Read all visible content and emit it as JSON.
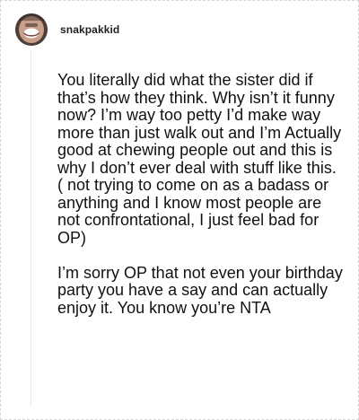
{
  "post": {
    "username": "snakpakkid",
    "avatar_icon": "user-avatar-icon",
    "paragraphs": [
      "You literally did what the sister did if that’s how they think. Why isn’t it funny now? I’m way too petty I’d make way more than just walk out and I’m Actually good at chewing people out and this is why I don’t ever deal with stuff like this. ( not trying to come on as a badass or anything and I know most people are not confrontational, I just feel bad for OP)",
      "I’m sorry OP that not even your birthday party you have a say and can actually enjoy it. You know you’re NTA"
    ]
  }
}
